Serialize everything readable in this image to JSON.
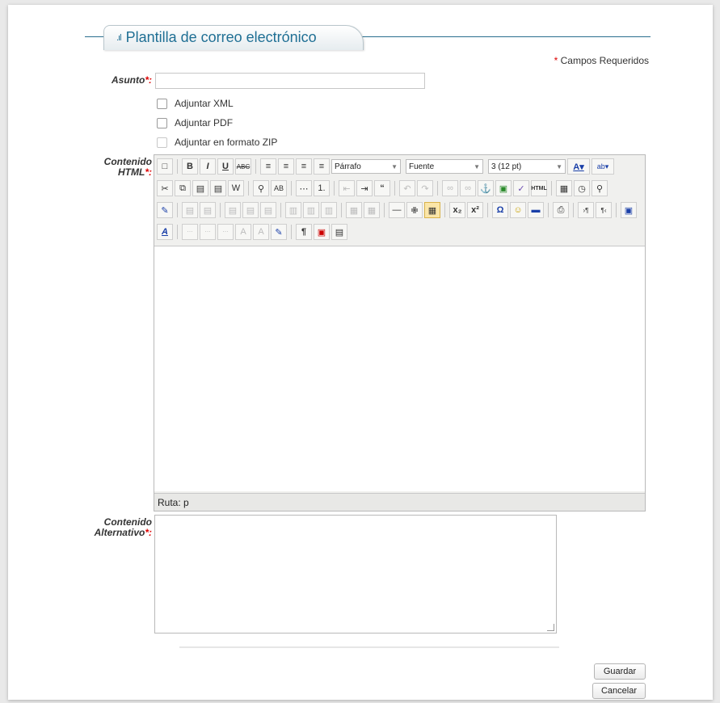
{
  "header": {
    "title": "Plantilla de correo electrónico",
    "icon": "bar-chart-icon"
  },
  "required_note": {
    "star": "*",
    "text": "Campos Requeridos"
  },
  "fields": {
    "asunto": {
      "label": "Asunto",
      "star": "*:",
      "value": "",
      "placeholder": ""
    },
    "contenido_html": {
      "label_line1": "Contenido",
      "label_line2": "HTML",
      "star": "*:"
    },
    "contenido_alternativo": {
      "label_line1": "Contenido",
      "label_line2": "Alternativo",
      "star": "*:",
      "value": ""
    }
  },
  "checkboxes": [
    {
      "label": "Adjuntar XML",
      "checked": false,
      "enabled": true
    },
    {
      "label": "Adjuntar PDF",
      "checked": false,
      "enabled": true
    },
    {
      "label": "Adjuntar en formato ZIP",
      "checked": false,
      "enabled": false
    }
  ],
  "editor": {
    "format_select": "Párrafo",
    "font_select": "Fuente",
    "size_select": "3 (12 pt)",
    "status_path": "Ruta: p"
  },
  "buttons": {
    "save": "Guardar",
    "cancel": "Cancelar"
  },
  "colors": {
    "accent": "#1f6f94",
    "required": "#dd0000"
  }
}
